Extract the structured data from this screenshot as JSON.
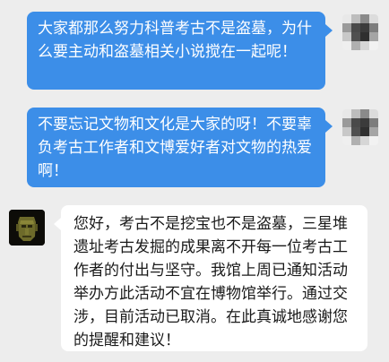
{
  "messages": [
    {
      "sender": "me",
      "text": "大家都那么努力科普考古不是盗墓，为什么要主动和盗墓相关小说搅在一起呢！"
    },
    {
      "sender": "me",
      "text": "不要忘记文物和文化是大家的呀！不要辜负考古工作者和文博爱好者对文物的热爱啊！"
    },
    {
      "sender": "museum",
      "text": "您好，考古不是挖宝也不是盗墓，三星堆遗址考古发掘的成果离不开每一位考古工作者的付出与坚守。我馆上周已通知活动举办方此活动不宜在博物馆举行。通过交涉，目前活动已取消。在此真诚地感谢您的提醒和建议！"
    }
  ],
  "colors": {
    "background": "#ededed",
    "outgoing_bubble": "#3c8ee8",
    "incoming_bubble": "#ffffff"
  },
  "avatars": {
    "me": "pixelated-user-avatar",
    "museum": "bronze-mask-avatar"
  }
}
